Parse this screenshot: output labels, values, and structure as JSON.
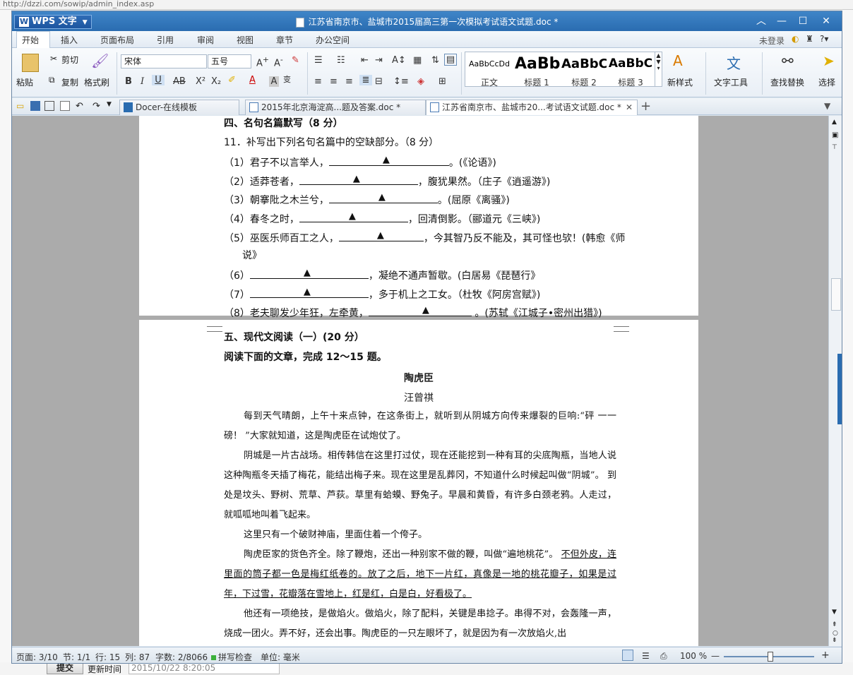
{
  "background": {
    "url": "http://dzzi.com/sowip/admin_index.asp",
    "submit_label": "提交",
    "update_time_label": "更新时间",
    "update_time_value": "2015/10/22 8:20:05"
  },
  "window": {
    "app_name": "WPS 文字",
    "title": "江苏省南京市、盐城市2015届高三第一次模拟考试语文试题.doc *",
    "controls": [
      "︿",
      "—",
      "☐",
      "✕"
    ]
  },
  "menu": {
    "items": [
      "开始",
      "插入",
      "页面布局",
      "引用",
      "审阅",
      "视图",
      "章节",
      "办公空间"
    ],
    "active": "开始",
    "login": "未登录"
  },
  "ribbon": {
    "paste": "粘贴",
    "cut": "剪切",
    "copy": "复制",
    "format_painter": "格式刷",
    "font_name": "宋体",
    "font_size": "五号",
    "styles": [
      {
        "sample": "AaBbCcDd",
        "label": "正文"
      },
      {
        "sample": "AaBb",
        "label": "标题 1"
      },
      {
        "sample": "AaBbC",
        "label": "标题 2"
      },
      {
        "sample": "AaBbC",
        "label": "标题 3"
      }
    ],
    "new_style": "新样式",
    "text_tools": "文字工具",
    "find_replace": "查找替换",
    "select": "选择"
  },
  "tabs": [
    {
      "label": "Docer-在线模板",
      "active": false
    },
    {
      "label": "2015年北京海淀高...题及答案.doc *",
      "active": false
    },
    {
      "label": "江苏省南京市、盐城市20...考试语文试题.doc *",
      "active": true
    }
  ],
  "document": {
    "section4_title": "四、名句名篇默写（8 分）",
    "q11": "11．补写出下列名句名篇中的空缺部分。（8 分）",
    "marker": "▲",
    "items": [
      {
        "pre": "（1）君子不以言举人，",
        "post": "。(《论语》)"
      },
      {
        "pre": "（2）适莽苍者，",
        "post": "，腹犹果然。（庄子《逍遥游》)"
      },
      {
        "pre": "（3）朝搴阰之木兰兮，",
        "post": "。(屈原《离骚》)"
      },
      {
        "pre": "（4）春冬之时，",
        "post": "，回清倒影。（郦道元《三峡》)"
      },
      {
        "pre": "（5）巫医乐师百工之人，",
        "post": "，今其智乃反不能及，其可怪也欤！(韩愈《师"
      },
      {
        "pre": "说》",
        "post": ""
      },
      {
        "pre": "（6）",
        "post": "，凝绝不通声暂歇。(白居易《琵琶行》"
      },
      {
        "pre": "（7）",
        "post": "，多于机上之工女。（杜牧《阿房宫赋》)"
      },
      {
        "pre": "（8）老夫聊发少年狂，左牵黄，",
        "post": " 。(苏轼《江城子•密州出猎》)"
      }
    ],
    "section5_title": "五、现代文阅读（一）(20 分）",
    "instruction": "阅读下面的文章，完成 12～15 题。",
    "article_title": "陶虎臣",
    "author": "汪曾祺",
    "paragraphs": [
      "每到天气晴朗，上午十来点钟，在这条街上，就听到从阴城方向传来爆裂的巨响:“砰 一一磅！ ”大家就知道，这是陶虎臣在试炮仗了。",
      "阴城是一片古战场。相传韩信在这里打过仗，现在还能挖到一种有耳的尖底陶瓶，当地人说这种陶瓶冬天插了梅花，能结出梅子来。现在这里是乱葬冈，不知道什么时候起叫做“阴城”。 到处是坟头、野树、荒草、芦荻。草里有蛤蟆、野兔子。早晨和黄昏，有许多白颈老鸦。人走过，就呱呱地叫着飞起来。",
      "这里只有一个破财神庙，里面住着一个侉子。"
    ],
    "para4_plain": "陶虎臣家的货色齐全。除了鞭炮，还出一种别家不做的鞭，叫做“遍地桃花”。",
    "para4_underlined": "不但外皮，连里面的筒子都一色是梅红纸卷的。放了之后，地下一片红，真像是一地的桃花瓣子，如果是过年，下过雪，花瓣落在雪地上，红是红，白是白，好看极了。",
    "para5": "他还有一项绝技，是做焰火。做焰火，除了配料，关键是串捻子。串得不对，会轰隆一声，烧成一团火。弄不好，还会出事。陶虎臣的一只左眼坏了，就是因为有一次放焰火,出"
  },
  "status": {
    "page": "页面: 3/10",
    "section": "节: 1/1",
    "row": "行: 15",
    "col": "列: 87",
    "words": "字数: 2/8066",
    "spell": "拼写检查",
    "unit": "单位: 毫米",
    "zoom": "100 %"
  },
  "colors": {
    "title_bar": "#2a6cb0",
    "accent": "#2a6cb0"
  }
}
